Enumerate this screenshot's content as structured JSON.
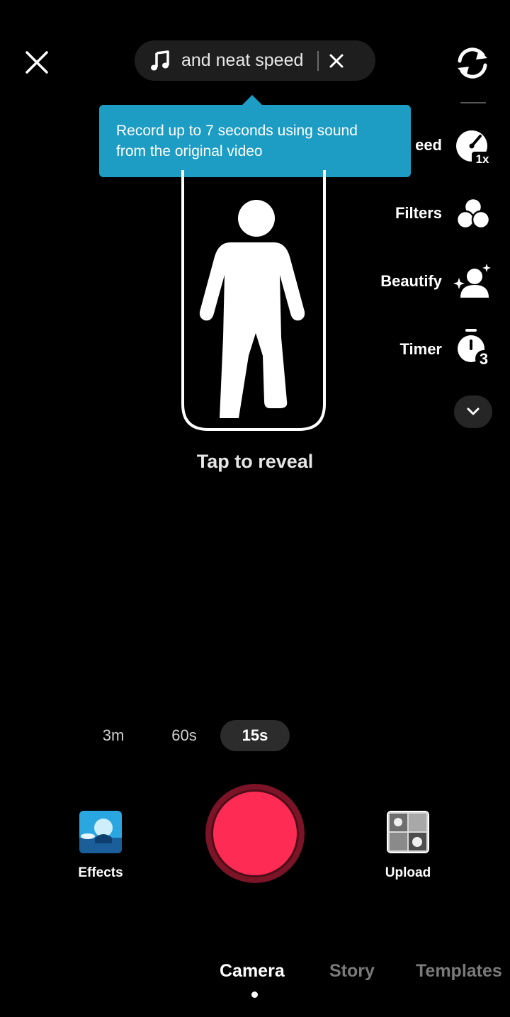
{
  "sound": {
    "title": "and neat speed"
  },
  "tooltip": {
    "line1": "Record up to 7 seconds using sound",
    "line2": "from the original video"
  },
  "tools": [
    {
      "label": "eed",
      "icon": "speed-icon",
      "badge": "1x"
    },
    {
      "label": "Filters",
      "icon": "filters-icon"
    },
    {
      "label": "Beautify",
      "icon": "beautify-icon"
    },
    {
      "label": "Timer",
      "icon": "timer-icon",
      "badge": "3"
    }
  ],
  "center": {
    "tap_text": "Tap to  reveal"
  },
  "durations": [
    {
      "label": "3m",
      "selected": false
    },
    {
      "label": "60s",
      "selected": false
    },
    {
      "label": "15s",
      "selected": true
    }
  ],
  "bottom": {
    "effects_label": "Effects",
    "upload_label": "Upload"
  },
  "modes": [
    {
      "label": "Camera",
      "active": true
    },
    {
      "label": "Story",
      "active": false
    },
    {
      "label": "Templates",
      "active": false
    }
  ],
  "colors": {
    "record": "#fe2c55",
    "record_ring": "#7a1426",
    "tooltip": "#1d9cc4"
  }
}
